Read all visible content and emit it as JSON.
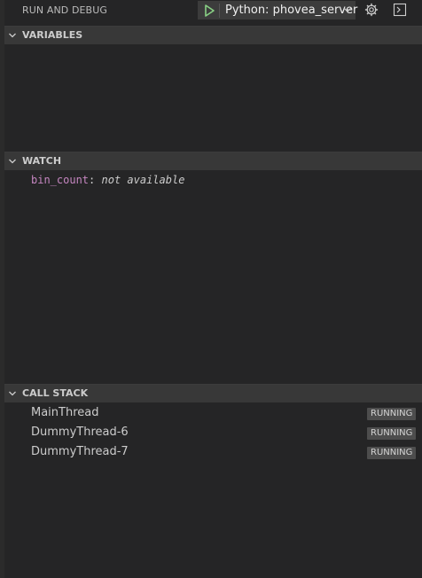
{
  "toolbar": {
    "title": "RUN AND DEBUG",
    "config_label": "Python: phovea_server",
    "icons": [
      "play-icon",
      "chevron-down-icon",
      "gear-icon",
      "terminal-icon"
    ]
  },
  "sections": {
    "variables": {
      "title": "VARIABLES"
    },
    "watch": {
      "title": "WATCH",
      "items": [
        {
          "name": "bin_count",
          "colon": ":",
          "value": "not available"
        }
      ]
    },
    "callstack": {
      "title": "CALL STACK",
      "threads": [
        {
          "name": "MainThread",
          "status": "RUNNING"
        },
        {
          "name": "DummyThread-6",
          "status": "RUNNING"
        },
        {
          "name": "DummyThread-7",
          "status": "RUNNING"
        }
      ]
    }
  },
  "colors": {
    "background": "#252526",
    "header": "#383838",
    "play_green": "#89d185",
    "watch_name": "#c586c0",
    "badge_bg": "#4d4d4d"
  }
}
